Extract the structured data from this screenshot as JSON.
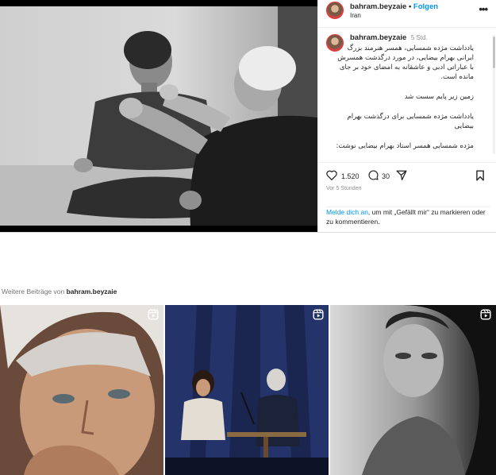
{
  "post": {
    "username": "bahram.beyzaie",
    "follow_label": "Folgen",
    "separator": "•",
    "location": "Iran",
    "more_label": "•••",
    "caption_time": "5 Std.",
    "caption_lines": [
      "یادداشت مژده شمسایی، همسر هنرمند بزرگ ایرانی بهرام بیضایی، در مورد درگذشت همسرش با عباراتی ادبی و عاشقانه به امضای خود بر جای مانده است.",
      "زمین زیر پایم سست شد",
      "یادداشت مژده شمسایی برای درگذشت بهرام بیضایی",
      "مژده شمسایی همسر استاد بهرام بیضایی نوشت:"
    ],
    "likes": "1.520",
    "comments": "30",
    "posted_ago": "Vor 5 Stunden",
    "login_link": "Melde dich an",
    "login_text": ", um mit „Gefällt mir“ zu markieren oder zu kommentieren."
  },
  "more_posts": {
    "prefix": "Weitere Beiträge von",
    "username": "bahram.beyzaie",
    "tiles": [
      {
        "type": "reel-icon"
      },
      {
        "type": "reel-icon"
      },
      {
        "type": "reel-icon"
      }
    ]
  },
  "colors": {
    "accent": "#0095f6",
    "text": "#262626",
    "muted": "#8e8e8e",
    "border": "#dbdbdb"
  }
}
